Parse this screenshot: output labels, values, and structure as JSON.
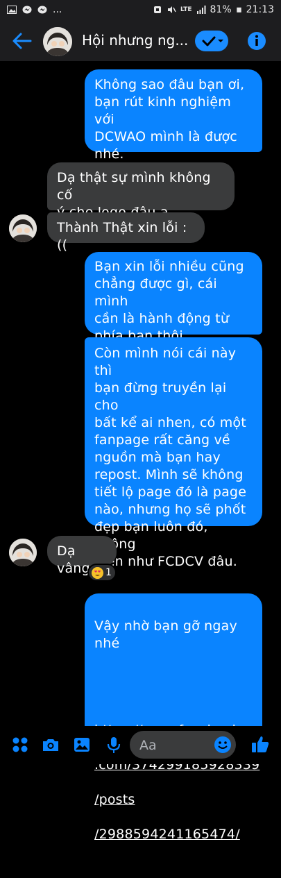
{
  "status_bar": {
    "icons_left": [
      "gallery-icon",
      "messenger-bubble-icon",
      "messenger-bubble-icon"
    ],
    "more": "...",
    "network": "LTE",
    "battery": "81%",
    "time": "21:13"
  },
  "header": {
    "title": "Hội nhưng ng...",
    "colors": {
      "bar": "#1d1d1f",
      "accent": "#1a8cff"
    }
  },
  "messages": [
    {
      "direction": "out",
      "text": "Không sao đâu bạn ơi,\nbạn rút kinh nghiệm với\nDCWAO mình là được\nnhé."
    },
    {
      "direction": "in",
      "text": "Dạ thật sự mình không cố\ný che logo đâu ạ"
    },
    {
      "direction": "in",
      "text": "Thành Thật xin lỗi :(("
    },
    {
      "direction": "out",
      "text": "Bạn xin lỗi nhiều cũng\nchẳng được gì, cái mình\ncần là hành động từ\nphía bạn thôi."
    },
    {
      "direction": "out",
      "text": "Còn mình nói cái này thì\nbạn đừng truyền lại cho\nbất kể ai nhen, có một\nfanpage rất căng về\nnguồn mà bạn hay\nrepost. Mình sẽ không\ntiết lộ page đó là page\nnào, nhưng họ sẽ phốt\nđẹp bạn luôn đó, không\nhiền như FCDCV đâu."
    },
    {
      "direction": "in",
      "text": "Dạ vâng",
      "reaction": {
        "emoji": "heart-eyes",
        "count": "1"
      }
    },
    {
      "direction": "out",
      "text": "Vậy nhờ bạn gỡ ngay\nnhé",
      "link_lines": [
        "https://www.facebook",
        ".com/374299185928339",
        "/posts",
        "/2988594241165474/"
      ]
    }
  ],
  "composer": {
    "placeholder": "Aa"
  },
  "colors": {
    "outgoing_bubble": "#0a84ff",
    "incoming_bubble": "#3a3b3c",
    "background": "#000000"
  }
}
